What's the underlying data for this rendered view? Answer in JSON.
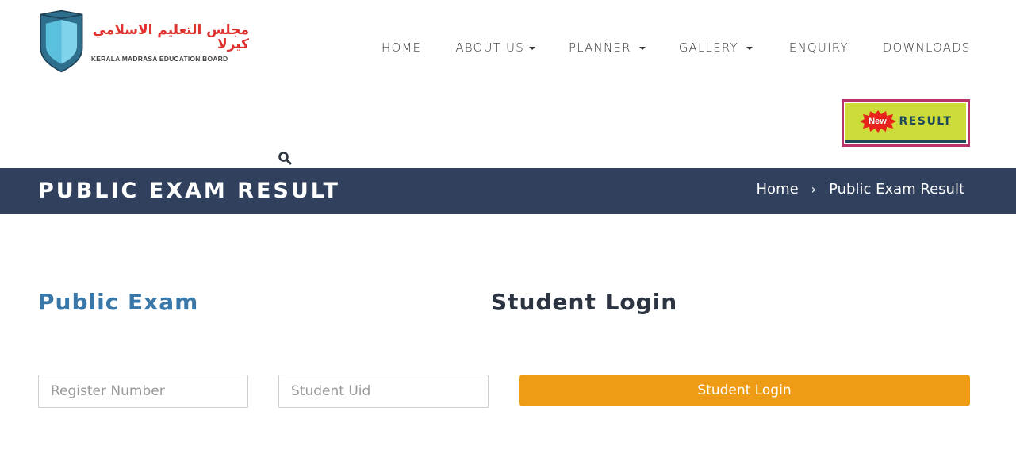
{
  "logo": {
    "arabic_text": "مجلس التعليم الاسلامي كيرلا",
    "english_text": "KERALA MADRASA EDUCATION BOARD",
    "colors": {
      "shield_light": "#5bc0de",
      "shield_dark": "#2e6f8e",
      "arabic": "#e0312f"
    }
  },
  "nav": {
    "items": [
      {
        "label": "HOME",
        "has_dropdown": false
      },
      {
        "label": "ABOUT US",
        "has_dropdown": true
      },
      {
        "label": "PLANNER",
        "has_dropdown": true
      },
      {
        "label": "GALLERY",
        "has_dropdown": true
      },
      {
        "label": "ENQUIRY",
        "has_dropdown": false
      },
      {
        "label": "DOWNLOADS",
        "has_dropdown": false
      }
    ]
  },
  "result_button": {
    "badge": "New",
    "label": "RESULT",
    "colors": {
      "background": "#cddc39",
      "border": "#b8336a",
      "text": "#1f4a5a",
      "badge": "#e8231b"
    }
  },
  "search": {
    "icon": "search-icon"
  },
  "banner": {
    "title": "PUBLIC EXAM RESULT",
    "breadcrumb": {
      "home": "Home",
      "separator": "›",
      "current": "Public Exam Result"
    },
    "color": "#30405d"
  },
  "main": {
    "left_heading": "Public Exam",
    "right_heading": "Student Login",
    "register_input": {
      "value": "",
      "placeholder": "Register Number"
    },
    "uid_input": {
      "value": "",
      "placeholder": "Student Uid"
    },
    "login_button": "Student Login",
    "accent_color": "#ee9b16"
  }
}
